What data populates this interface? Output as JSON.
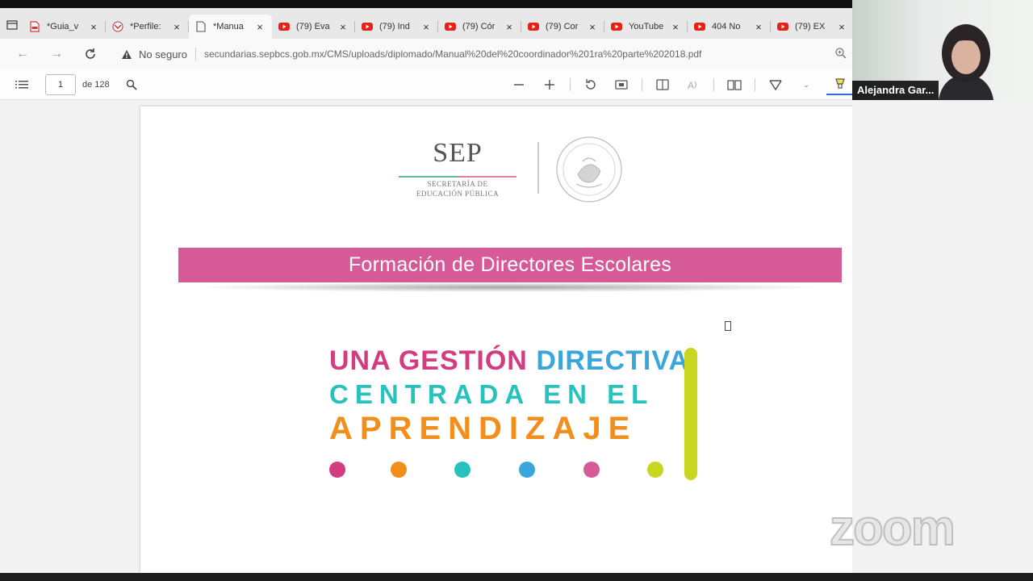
{
  "tabs": [
    {
      "title": "*Guia_v",
      "icon": "pdf-icon",
      "active": false
    },
    {
      "title": "*Perfile:",
      "icon": "app-icon",
      "active": false
    },
    {
      "title": "*Manua",
      "icon": "document-icon",
      "active": true
    },
    {
      "title": "(79) Eva",
      "icon": "youtube-icon",
      "active": false
    },
    {
      "title": "(79) Ind",
      "icon": "youtube-icon",
      "active": false
    },
    {
      "title": "(79) Cór",
      "icon": "youtube-icon",
      "active": false
    },
    {
      "title": "(79) Cor",
      "icon": "youtube-icon",
      "active": false
    },
    {
      "title": "YouTube",
      "icon": "youtube-icon",
      "active": false
    },
    {
      "title": "404 No",
      "icon": "youtube-icon",
      "active": false
    },
    {
      "title": "(79) EX",
      "icon": "youtube-icon",
      "active": false
    }
  ],
  "address": {
    "security_label": "No seguro",
    "url": "secundarias.sepbcs.gob.mx/CMS/uploads/diplomado/Manual%20del%20coordinador%201ra%20parte%202018.pdf"
  },
  "pdf_toolbar": {
    "page_current": "1",
    "page_total": "de 128"
  },
  "document": {
    "sep_word": "SEP",
    "sep_sub1": "SECRETARÍA DE",
    "sep_sub2": "EDUCACIÓN PÚBLICA",
    "banner": "Formación de Directores Escolares",
    "title_line1_a": "UNA GESTIÓN",
    "title_line1_b": "DIRECTIVA",
    "title_line2": "CENTRADA EN EL",
    "title_line3": "APRENDIZAJE",
    "dot_colors": [
      "#d23d7f",
      "#f28e1c",
      "#27c2bd",
      "#3aa6dc",
      "#d65a98",
      "#c9d61f"
    ]
  },
  "participant": {
    "name": "Alejandra Gar..."
  },
  "watermark": "zoom",
  "colors": {
    "banner": "#d65a98",
    "youtube": "#e62117",
    "accent_bar": "#c9d61f"
  }
}
